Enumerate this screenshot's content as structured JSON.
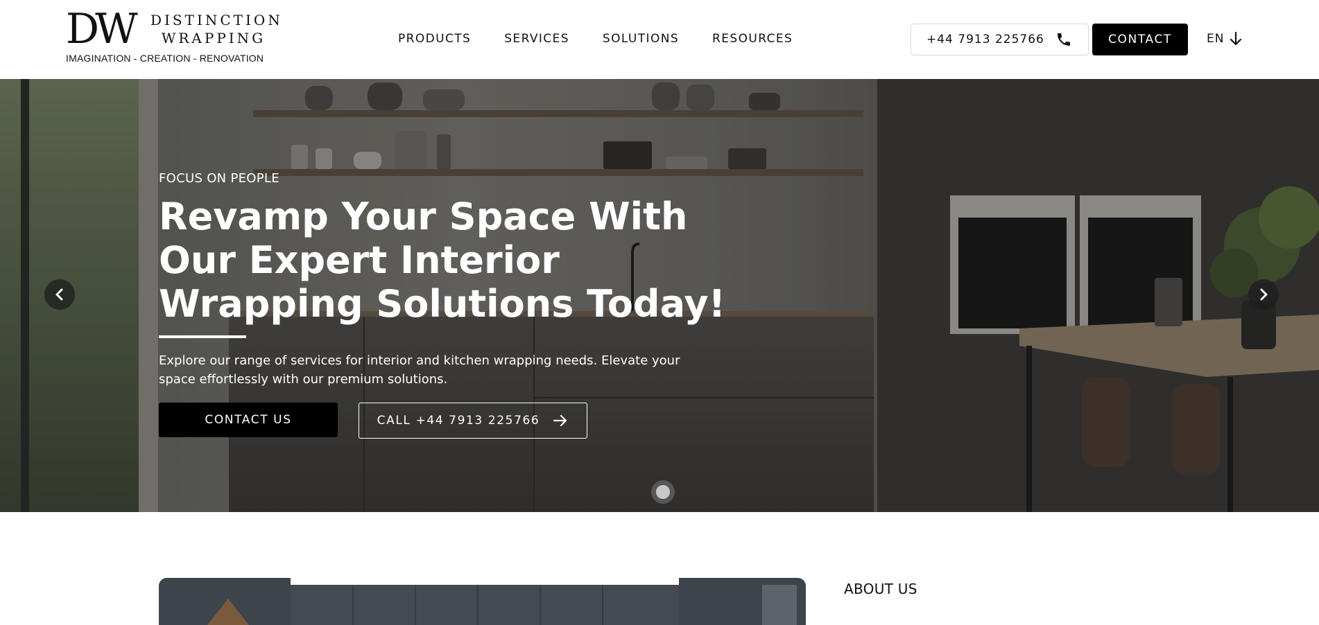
{
  "logo": {
    "mark": "DW",
    "name_line1": "DISTINCTION",
    "name_line2": "WRAPPING",
    "tagline": "IMAGINATION - CREATION - RENOVATION"
  },
  "nav": {
    "items": [
      {
        "label": "PRODUCTS"
      },
      {
        "label": "SERVICES"
      },
      {
        "label": "SOLUTIONS"
      },
      {
        "label": "RESOURCES"
      }
    ]
  },
  "header": {
    "phone": "+44 7913 225766",
    "phone_icon": "phone-icon",
    "contact_label": "CONTACT",
    "language": "EN",
    "language_icon": "arrow-down-icon"
  },
  "hero": {
    "eyebrow": "FOCUS ON PEOPLE",
    "headline_lines": [
      "Revamp Your Space With",
      "Our Expert Interior",
      "Wrapping Solutions Today!"
    ],
    "description": "Explore our range of services for interior and kitchen wrapping needs. Elevate your space effortlessly with our premium solutions.",
    "cta_primary": "CONTACT US",
    "cta_secondary": "CALL +44 7913 225766",
    "cta_secondary_icon": "arrow-right-icon",
    "prev_icon": "chevron-left-icon",
    "next_icon": "chevron-right-icon",
    "slide_count": 1,
    "active_slide": 1
  },
  "about": {
    "label": "ABOUT US"
  },
  "colors": {
    "primary": "#000000",
    "background": "#ffffff",
    "hero_text": "#ffffff"
  }
}
